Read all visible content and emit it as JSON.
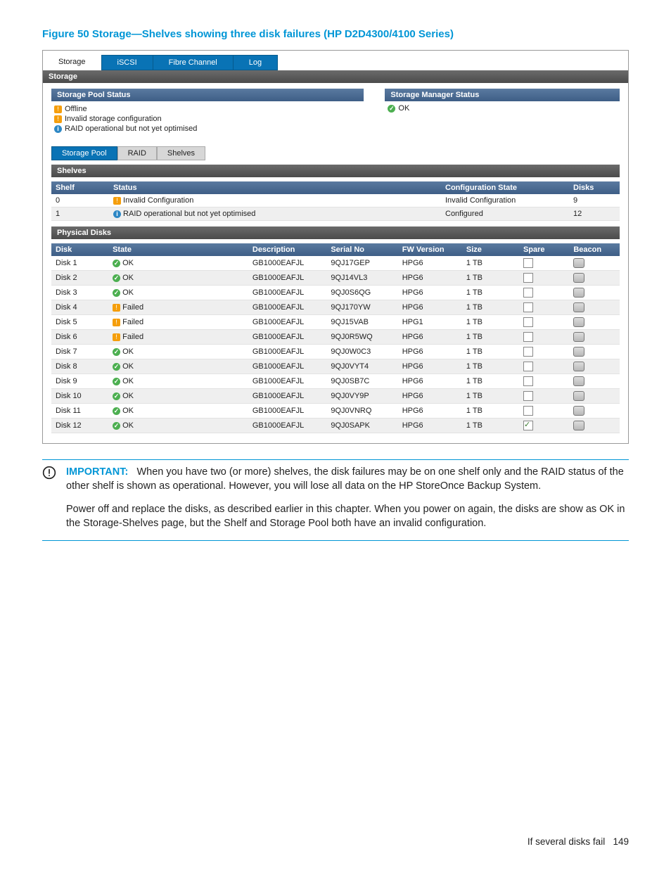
{
  "figure_title": "Figure 50 Storage—Shelves showing three disk failures (HP D2D4300/4100 Series)",
  "tabs": [
    "Storage",
    "iSCSI",
    "Fibre Channel",
    "Log"
  ],
  "panel_title": "Storage",
  "storage_pool_status_title": "Storage Pool Status",
  "storage_pool_status": [
    {
      "icon": "warn",
      "text": "Offline"
    },
    {
      "icon": "warn",
      "text": "Invalid storage configuration"
    },
    {
      "icon": "info",
      "text": "RAID operational but not yet optimised"
    }
  ],
  "storage_mgr_title": "Storage Manager Status",
  "storage_mgr_status": {
    "icon": "ok",
    "text": "OK"
  },
  "subtabs": [
    "Storage Pool",
    "RAID",
    "Shelves"
  ],
  "shelves_bar": "Shelves",
  "shelves_headers": [
    "Shelf",
    "Status",
    "Configuration State",
    "Disks"
  ],
  "shelves_rows": [
    {
      "shelf": "0",
      "status_icon": "warn",
      "status": "Invalid Configuration",
      "config": "Invalid Configuration",
      "disks": "9"
    },
    {
      "shelf": "1",
      "status_icon": "info",
      "status": "RAID operational but not yet optimised",
      "config": "Configured",
      "disks": "12"
    }
  ],
  "phys_bar": "Physical Disks",
  "disk_headers": [
    "Disk",
    "State",
    "Description",
    "Serial No",
    "FW Version",
    "Size",
    "Spare",
    "Beacon"
  ],
  "disks": [
    {
      "disk": "Disk 1",
      "icon": "ok",
      "state": "OK",
      "desc": "GB1000EAFJL",
      "serial": "9QJ17GEP",
      "fw": "HPG6",
      "size": "1 TB",
      "spare": false
    },
    {
      "disk": "Disk 2",
      "icon": "ok",
      "state": "OK",
      "desc": "GB1000EAFJL",
      "serial": "9QJ14VL3",
      "fw": "HPG6",
      "size": "1 TB",
      "spare": false
    },
    {
      "disk": "Disk 3",
      "icon": "ok",
      "state": "OK",
      "desc": "GB1000EAFJL",
      "serial": "9QJ0S6QG",
      "fw": "HPG6",
      "size": "1 TB",
      "spare": false
    },
    {
      "disk": "Disk 4",
      "icon": "warn",
      "state": "Failed",
      "desc": "GB1000EAFJL",
      "serial": "9QJ170YW",
      "fw": "HPG6",
      "size": "1 TB",
      "spare": false
    },
    {
      "disk": "Disk 5",
      "icon": "warn",
      "state": "Failed",
      "desc": "GB1000EAFJL",
      "serial": "9QJ15VAB",
      "fw": "HPG1",
      "size": "1 TB",
      "spare": false
    },
    {
      "disk": "Disk 6",
      "icon": "warn",
      "state": "Failed",
      "desc": "GB1000EAFJL",
      "serial": "9QJ0R5WQ",
      "fw": "HPG6",
      "size": "1 TB",
      "spare": false
    },
    {
      "disk": "Disk 7",
      "icon": "ok",
      "state": "OK",
      "desc": "GB1000EAFJL",
      "serial": "9QJ0W0C3",
      "fw": "HPG6",
      "size": "1 TB",
      "spare": false
    },
    {
      "disk": "Disk 8",
      "icon": "ok",
      "state": "OK",
      "desc": "GB1000EAFJL",
      "serial": "9QJ0VYT4",
      "fw": "HPG6",
      "size": "1 TB",
      "spare": false
    },
    {
      "disk": "Disk 9",
      "icon": "ok",
      "state": "OK",
      "desc": "GB1000EAFJL",
      "serial": "9QJ0SB7C",
      "fw": "HPG6",
      "size": "1 TB",
      "spare": false
    },
    {
      "disk": "Disk 10",
      "icon": "ok",
      "state": "OK",
      "desc": "GB1000EAFJL",
      "serial": "9QJ0VY9P",
      "fw": "HPG6",
      "size": "1 TB",
      "spare": false
    },
    {
      "disk": "Disk 11",
      "icon": "ok",
      "state": "OK",
      "desc": "GB1000EAFJL",
      "serial": "9QJ0VNRQ",
      "fw": "HPG6",
      "size": "1 TB",
      "spare": false
    },
    {
      "disk": "Disk 12",
      "icon": "ok",
      "state": "OK",
      "desc": "GB1000EAFJL",
      "serial": "9QJ0SAPK",
      "fw": "HPG6",
      "size": "1 TB",
      "spare": true
    }
  ],
  "important_label": "IMPORTANT:",
  "important_text": "When you have two (or more) shelves, the disk failures may be on one shelf only and the RAID status of the other shelf is shown as operational. However, you will lose all data on the HP StoreOnce Backup System.",
  "para2": "Power off and replace the disks, as described earlier in this chapter. When you power on again, the disks are show as OK in the Storage-Shelves page, but the Shelf and Storage Pool both have an invalid configuration.",
  "footer_text": "If several disks fail",
  "footer_page": "149"
}
